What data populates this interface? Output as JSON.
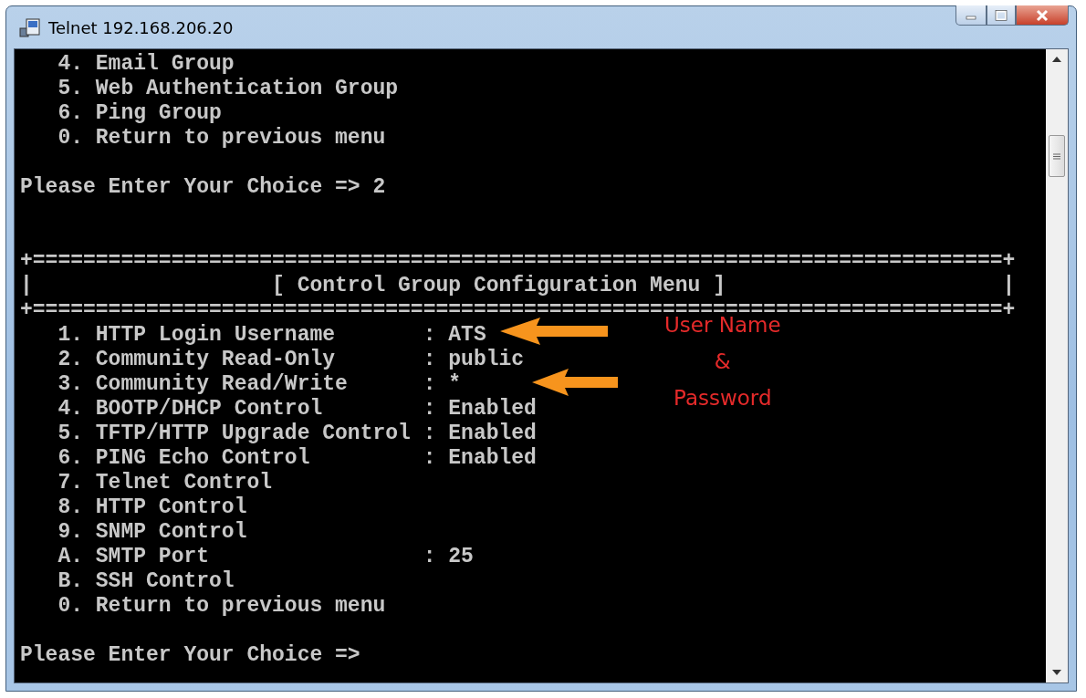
{
  "window": {
    "title": "Telnet 192.168.206.20"
  },
  "terminal": {
    "previous_menu": [
      "4. Email Group",
      "5. Web Authentication Group",
      "6. Ping Group",
      "0. Return to previous menu"
    ],
    "prompt_1": "Please Enter Your Choice => 2",
    "border_top": "+=============================================================================+",
    "box_left": "|",
    "box_title": "[ Control Group Configuration Menu ]",
    "box_right": "|",
    "border_bottom": "+=============================================================================+",
    "menu": [
      "1. HTTP Login Username       : ATS",
      "2. Community Read-Only       : public",
      "3. Community Read/Write      : *",
      "4. BOOTP/DHCP Control        : Enabled",
      "5. TFTP/HTTP Upgrade Control : Enabled",
      "6. PING Echo Control         : Enabled",
      "7. Telnet Control",
      "8. HTTP Control",
      "9. SNMP Control",
      "A. SMTP Port                 : 25",
      "B. SSH Control",
      "0. Return to previous menu"
    ],
    "prompt_2": "Please Enter Your Choice =>"
  },
  "annotation": {
    "lines": [
      "User Name",
      "&",
      "Password"
    ]
  }
}
